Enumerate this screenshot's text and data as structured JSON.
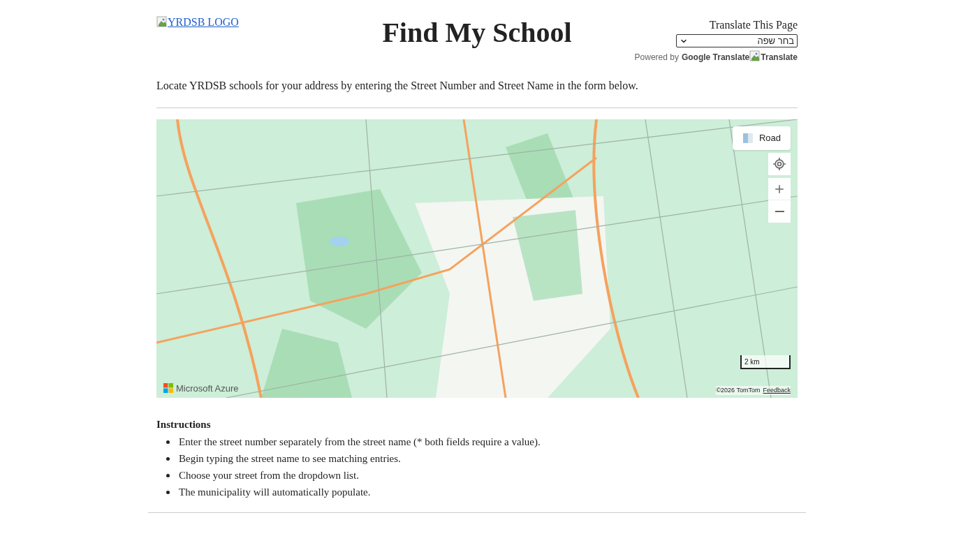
{
  "header": {
    "logo_alt": "YRDSB LOGO",
    "title": "Find My School",
    "translate": {
      "label": "Translate This Page",
      "language_select": "בחר שפה",
      "powered_by": "Powered by",
      "provider": "Google Translate",
      "button": "Translate"
    }
  },
  "intro": "Locate YRDSB schools for your address by entering the Street Number and Street Name in the form below.",
  "map": {
    "kind": "picture",
    "style_button": "Road",
    "scale": "2 km",
    "brand": "Microsoft Azure",
    "attribution": "©2026 TomTom",
    "feedback": "Feedback"
  },
  "instructions": {
    "heading": "Instructions",
    "items": [
      "Enter the street number separately from the street name (* both fields require a value).",
      "Begin typing the street name to see matching entries.",
      "Choose your street from the dropdown list.",
      "The municipality will automatically populate."
    ]
  }
}
